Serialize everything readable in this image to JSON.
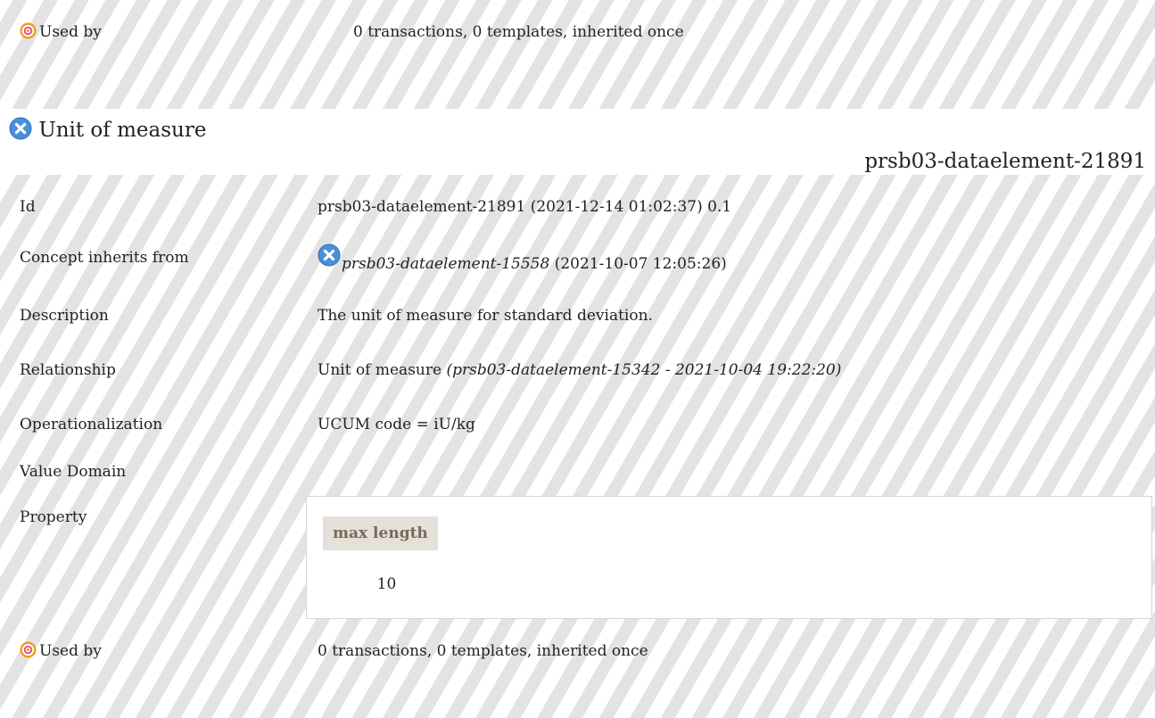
{
  "top_row": {
    "label": "Used by",
    "value": "0 transactions, 0 templates, inherited once",
    "icon": "target-icon"
  },
  "concept": {
    "title": "Unit of measure",
    "id_heading": "prsb03-dataelement-21891",
    "icon": "x-circle-icon",
    "id": {
      "label": "Id",
      "value": "prsb03-dataelement-21891 (2021-12-14 01:02:37) 0.1"
    },
    "inherits": {
      "label": "Concept inherits from",
      "ref_id": "prsb03-dataelement-15558",
      "ref_date": "(2021-10-07 12:05:26)"
    },
    "description": {
      "label": "Description",
      "value": "The unit of measure for standard deviation."
    },
    "relationship": {
      "label": "Relationship",
      "name": "Unit of measure",
      "ref": "(prsb03-dataelement-15342 - 2021-10-04 19:22:20)"
    },
    "operationalization": {
      "label": "Operationalization",
      "value": "UCUM code = iU/kg"
    },
    "value_domain": {
      "label": "Value Domain"
    },
    "property": {
      "label": "Property",
      "header": "max length",
      "value": "10"
    },
    "used_by": {
      "label": "Used by",
      "value": "0 transactions, 0 templates, inherited once"
    }
  },
  "colors": {
    "target_outer": "#f39c12",
    "x_icon": "#4a90d9",
    "header_bg": "#e5e0d9",
    "header_text": "#7a6a55"
  }
}
